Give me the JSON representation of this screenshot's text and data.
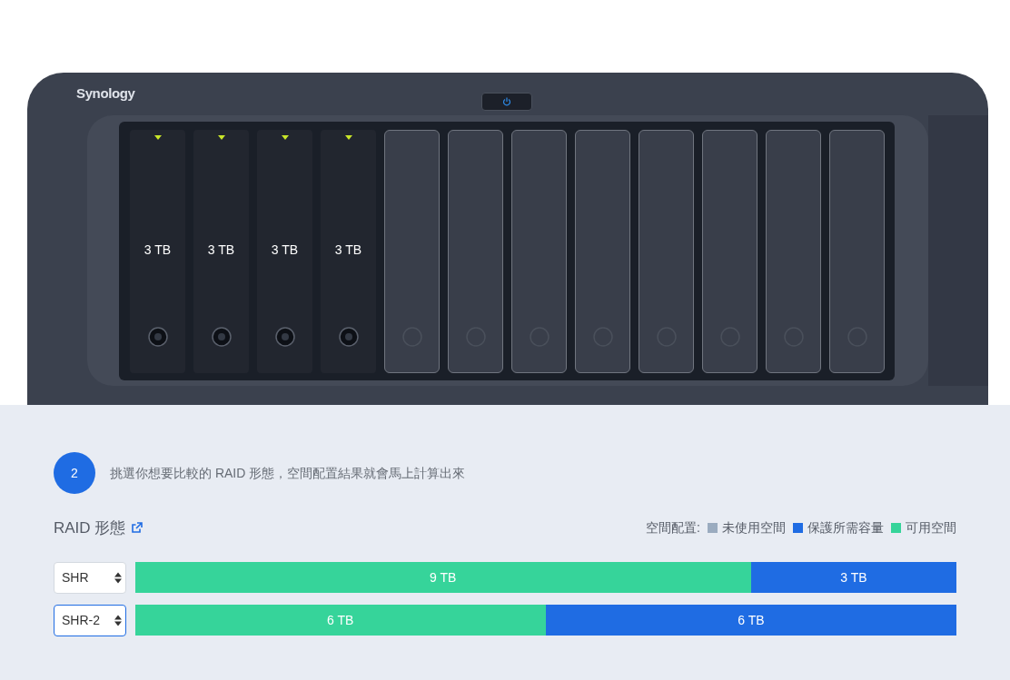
{
  "device": {
    "brand": "Synology",
    "bays": [
      {
        "installed": true,
        "capacity": "3 TB"
      },
      {
        "installed": true,
        "capacity": "3 TB"
      },
      {
        "installed": true,
        "capacity": "3 TB"
      },
      {
        "installed": true,
        "capacity": "3 TB"
      },
      {
        "installed": false
      },
      {
        "installed": false
      },
      {
        "installed": false
      },
      {
        "installed": false
      },
      {
        "installed": false
      },
      {
        "installed": false
      },
      {
        "installed": false
      },
      {
        "installed": false
      }
    ]
  },
  "step": {
    "number": "2",
    "instruction": "挑選你想要比較的 RAID 形態，空間配置結果就會馬上計算出來"
  },
  "raid_title": "RAID 形態",
  "legend": {
    "label": "空間配置:",
    "items": [
      {
        "kind": "unused",
        "label": "未使用空間",
        "color": "#9aabbf"
      },
      {
        "kind": "protection",
        "label": "保護所需容量",
        "color": "#1f6ce3"
      },
      {
        "kind": "available",
        "label": "可用空間",
        "color": "#36d49a"
      }
    ]
  },
  "rows": [
    {
      "raid": "SHR",
      "selected": false,
      "segments": [
        {
          "kind": "available",
          "level": 0.75,
          "label": "9 TB"
        },
        {
          "kind": "protection",
          "level": 0.25,
          "label": "3 TB"
        }
      ]
    },
    {
      "raid": "SHR-2",
      "selected": true,
      "segments": [
        {
          "kind": "available",
          "level": 0.5,
          "label": "6 TB"
        },
        {
          "kind": "protection",
          "level": 0.5,
          "label": "6 TB"
        }
      ]
    }
  ]
}
